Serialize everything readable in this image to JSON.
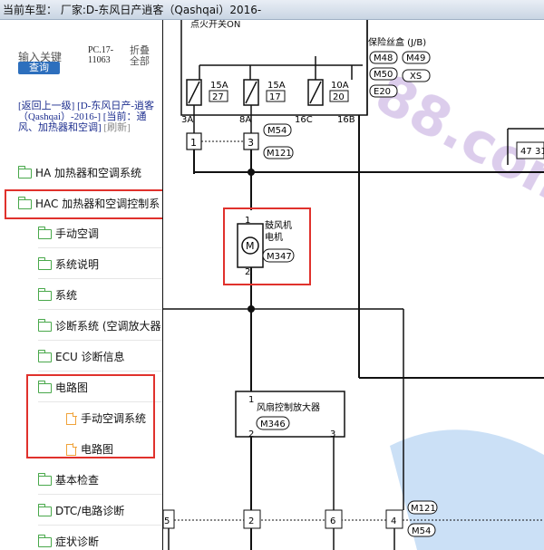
{
  "titlebar": {
    "text": "当前车型：  厂家:D-东风日产逍客（Qashqai）2016-"
  },
  "sidebar": {
    "search_label": "输入关键",
    "search_button": "查询",
    "pc_code": "PC.17-11063",
    "fold_all": "折叠全部",
    "nav_back": "[返回上一级]",
    "nav_parent": "[D-东风日产-逍客（Qashqai）-2016-]",
    "nav_current": "[当前：通风、加热器和空调]",
    "nav_refresh": "[刷新]",
    "items": [
      {
        "label": "HA 加热器和空调系统",
        "icon": "folder-icon"
      },
      {
        "label": "HAC 加热器和空调控制系",
        "icon": "folder-icon"
      },
      {
        "label": "手动空调",
        "icon": "folder-icon"
      },
      {
        "label": "系统说明",
        "icon": "folder-icon"
      },
      {
        "label": "系统",
        "icon": "folder-icon"
      },
      {
        "label": "诊断系统 (空调放大器",
        "icon": "folder-icon"
      },
      {
        "label": "ECU 诊断信息",
        "icon": "folder-icon"
      },
      {
        "label": "电路图",
        "icon": "folder-open-icon"
      },
      {
        "label": "手动空调系统",
        "icon": "document-icon"
      },
      {
        "label": "电路图",
        "icon": "document-icon"
      },
      {
        "label": "基本检查",
        "icon": "folder-icon"
      },
      {
        "label": "DTC/电路诊断",
        "icon": "folder-icon"
      },
      {
        "label": "症状诊断",
        "icon": "folder-icon"
      }
    ]
  },
  "diagram": {
    "fuse_box_label": "保险丝盒 (J/B)",
    "top_partial_label": "点火开关ON",
    "connectors_top_right": [
      "M48",
      "M49",
      "M50",
      "XS",
      "E20"
    ],
    "fuses": [
      {
        "amp": "15A",
        "num": "27",
        "pin": "3A"
      },
      {
        "amp": "15A",
        "num": "17",
        "pin": "8A"
      },
      {
        "amp": "10A",
        "num": "20",
        "pin": "16C"
      },
      {
        "amp": "",
        "num": "",
        "pin": "16B"
      }
    ],
    "joint_pins": [
      "1",
      "3"
    ],
    "joint_connectors": [
      "M54",
      "M121"
    ],
    "blower_motor": {
      "label_line1": "鼓风机",
      "label_line2": "电机",
      "connector": "M347",
      "pin_top": "1",
      "pin_bottom": "2",
      "symbol": "M"
    },
    "amplifier": {
      "label": "风扇控制放大器",
      "connector": "M346",
      "pin1": "1",
      "pin2": "2",
      "pin3": "3"
    },
    "bottom_pins": [
      "5",
      "2",
      "6",
      "4"
    ],
    "bottom_connectors": [
      "M121",
      "M54"
    ],
    "right_edge_pins": [
      "47",
      "31"
    ],
    "watermark": "88.com"
  },
  "colors": {
    "highlight": "#e0312c",
    "folder": "#49a84b",
    "doc": "#f0a33a",
    "button": "#2d6fbd"
  }
}
